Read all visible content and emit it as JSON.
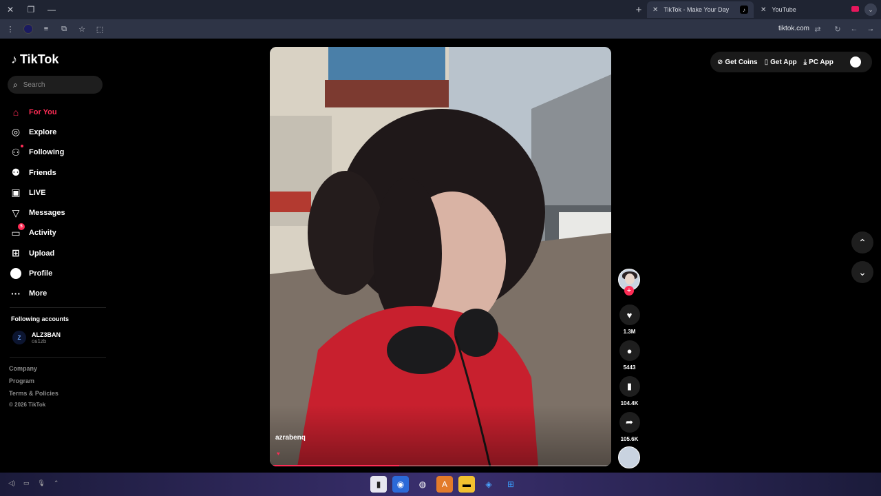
{
  "browser": {
    "tabs": [
      {
        "title": "TikTok - Make Your Day",
        "active": true
      },
      {
        "title": "YouTube",
        "active": false
      }
    ],
    "url": "tiktok.com"
  },
  "sidebar": {
    "logo": "TikTok",
    "search_placeholder": "Search",
    "nav": [
      {
        "label": "For You",
        "icon": "home-icon",
        "active": true
      },
      {
        "label": "Explore",
        "icon": "compass-icon"
      },
      {
        "label": "Following",
        "icon": "following-icon"
      },
      {
        "label": "Friends",
        "icon": "friends-icon"
      },
      {
        "label": "LIVE",
        "icon": "live-icon"
      },
      {
        "label": "Messages",
        "icon": "messages-icon"
      },
      {
        "label": "Activity",
        "icon": "activity-icon",
        "badge": "5"
      },
      {
        "label": "Upload",
        "icon": "upload-icon"
      },
      {
        "label": "Profile",
        "icon": "profile-icon"
      },
      {
        "label": "More",
        "icon": "more-icon"
      }
    ],
    "following_title": "Following accounts",
    "following": [
      {
        "name": "ALZ3BAN",
        "handle": "os1zb",
        "avatar_text": "Z"
      }
    ],
    "footer": [
      "Company",
      "Program",
      "Terms & Policies"
    ],
    "copyright": "© 2026 TikTok"
  },
  "video": {
    "author": "azrabenq",
    "progress": 0.38
  },
  "actions": {
    "likes": "1.3M",
    "comments": "5443",
    "saves": "104.4K",
    "shares": "105.6K"
  },
  "topbar": {
    "get_coins": "Get Coins",
    "get_app": "Get App",
    "pc_app": "PC App"
  },
  "colors": {
    "accent": "#fe2c55",
    "background": "#000000"
  }
}
